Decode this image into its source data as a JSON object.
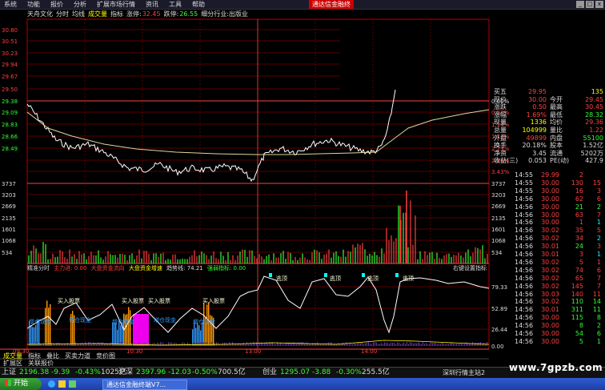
{
  "menu": [
    "系统",
    "功能",
    "报价",
    "分析",
    "扩展市场行情",
    "资讯",
    "工具",
    "帮助"
  ],
  "window_title": "通达信金融终",
  "window_buttons": [
    "_",
    "□",
    "x"
  ],
  "chart_header": {
    "stock_name": "天舟文化",
    "tabs": [
      "分时",
      "均线",
      "成交量",
      "指标"
    ],
    "limit_up_label": "涨停:",
    "limit_up_value": "32.45",
    "limit_down_label": "跌停:",
    "limit_down_value": "26.55",
    "industry": "细分行业:出版业"
  },
  "price_axis_left": [
    "30.80",
    "30.51",
    "30.23",
    "29.94",
    "29.67",
    "29.50",
    "29.38",
    "29.09",
    "28.83",
    "28.66",
    "28.49"
  ],
  "price_axis_right_pct": [
    "0.00%",
    "0.57%",
    "1.14%",
    "1.71%",
    "2.29%",
    "2.86%",
    "3.43%"
  ],
  "volume_axis_left": [
    "3737",
    "3203",
    "2669",
    "2135",
    "1601",
    "1068",
    "534"
  ],
  "volume_axis_right": [
    "3737",
    "3203",
    "2669",
    "2135",
    "1601",
    "1068",
    "534"
  ],
  "indicator_header": {
    "name": "精准分时",
    "items": [
      {
        "label": "主力进: 0.00",
        "color": "#ff4040"
      },
      {
        "label": "大盘资金流向",
        "color": "#ff4040"
      },
      {
        "label": "大盘资金增速",
        "color": "#ff0"
      },
      {
        "label": "趋势线: 74.21",
        "color": "#ddd"
      },
      {
        "label": "强弱指标: 0.00",
        "color": "#3f3"
      }
    ],
    "right_label": "右键设置指标"
  },
  "indicator_axis_right": [
    "79.33",
    "52.89",
    "26.44",
    "0.00"
  ],
  "indicator_labels": {
    "buy": "买入股票",
    "add": "增仓现金",
    "tao": "逃顶"
  },
  "time_axis": [
    "09:30",
    "10:30",
    "13:00",
    "14:00"
  ],
  "bottom_tabs": [
    "成交量",
    "指标",
    "叠比",
    "买卖力道",
    "竞价图"
  ],
  "bottom_tabs2": [
    "扩展区",
    "关联报价"
  ],
  "quote_panel": [
    {
      "l": "买五",
      "v": "29.95",
      "l2": "",
      "v2": "135",
      "c": "#ff4040",
      "c2": "#ff0"
    },
    {
      "l": "现价",
      "v": "30.00",
      "l2": "今开",
      "v2": "29.45",
      "c": "#ff4040",
      "c2": "#ff4040"
    },
    {
      "l": "涨跌",
      "v": "0.50",
      "l2": "最高",
      "v2": "30.45",
      "c": "#ff4040",
      "c2": "#ff4040"
    },
    {
      "l": "涨幅",
      "v": "1.69%",
      "l2": "最低",
      "v2": "28.32",
      "c": "#ff4040",
      "c2": "#3f3"
    },
    {
      "l": "现量",
      "v": "1336",
      "l2": "均价",
      "v2": "29.36",
      "c": "#ff0",
      "c2": "#ff4040"
    },
    {
      "l": "总量",
      "v": "104999",
      "l2": "量比",
      "v2": "1.22",
      "c": "#ff0",
      "c2": "#ff4040"
    },
    {
      "l": "外盘",
      "v": "49899",
      "l2": "内盘",
      "v2": "55100",
      "c": "#ff4040",
      "c2": "#3f3"
    },
    {
      "l": "换手",
      "v": "20.18%",
      "l2": "股本",
      "v2": "1.52亿",
      "c": "#ddd",
      "c2": "#ddd"
    },
    {
      "l": "净资",
      "v": "3.45",
      "l2": "流通",
      "v2": "5202万",
      "c": "#ddd",
      "c2": "#ddd"
    },
    {
      "l": "收益(三)",
      "v": "0.053",
      "l2": "PE(动)",
      "v2": "427.9",
      "c": "#ddd",
      "c2": "#ddd"
    }
  ],
  "ticks": [
    {
      "t": "14:55",
      "p": "29.99",
      "v": "2",
      "c": "#ff4040",
      "d": "",
      "dc": "#ff4040"
    },
    {
      "t": "14:55",
      "p": "30.00",
      "v": "130",
      "c": "#ff4040",
      "d": "15",
      "dc": "#ff4040"
    },
    {
      "t": "14:55",
      "p": "30.00",
      "v": "16",
      "c": "#ff4040",
      "d": "3",
      "dc": "#ff4040"
    },
    {
      "t": "14:56",
      "p": "30.00",
      "v": "62",
      "c": "#ff4040",
      "d": "6",
      "dc": "#ff4040"
    },
    {
      "t": "14:56",
      "p": "30.00",
      "v": "21",
      "c": "#3f3",
      "d": "2",
      "dc": "#3f3"
    },
    {
      "t": "14:56",
      "p": "30.00",
      "v": "63",
      "c": "#ff4040",
      "d": "7",
      "dc": "#ff4040"
    },
    {
      "t": "14:56",
      "p": "30.00",
      "v": "1",
      "c": "#ff4040",
      "d": "1",
      "dc": "#0ff"
    },
    {
      "t": "14:56",
      "p": "30.02",
      "v": "35",
      "c": "#ff4040",
      "d": "5",
      "dc": "#ff4040"
    },
    {
      "t": "14:56",
      "p": "30.02",
      "v": "34",
      "c": "#ff4040",
      "d": "2",
      "dc": "#0ff"
    },
    {
      "t": "14:56",
      "p": "30.01",
      "v": "24",
      "c": "#3f3",
      "d": "3",
      "dc": "#ff4040"
    },
    {
      "t": "14:56",
      "p": "30.01",
      "v": "3",
      "c": "#ff4040",
      "d": "1",
      "dc": "#0ff"
    },
    {
      "t": "14:56",
      "p": "30.02",
      "v": "5",
      "c": "#ff4040",
      "d": "1",
      "dc": "#ff4040"
    },
    {
      "t": "14:56",
      "p": "30.02",
      "v": "74",
      "c": "#ff4040",
      "d": "6",
      "dc": "#ff4040"
    },
    {
      "t": "14:56",
      "p": "30.02",
      "v": "65",
      "c": "#ff4040",
      "d": "7",
      "dc": "#ff4040"
    },
    {
      "t": "14:56",
      "p": "30.02",
      "v": "145",
      "c": "#ff4040",
      "d": "7",
      "dc": "#ff4040"
    },
    {
      "t": "14:56",
      "p": "30.03",
      "v": "140",
      "c": "#ff4040",
      "d": "11",
      "dc": "#ff4040"
    },
    {
      "t": "14:56",
      "p": "30.02",
      "v": "110",
      "c": "#3f3",
      "d": "14",
      "dc": "#3f3"
    },
    {
      "t": "14:56",
      "p": "30.01",
      "v": "311",
      "c": "#3f3",
      "d": "11",
      "dc": "#3f3"
    },
    {
      "t": "14:56",
      "p": "30.00",
      "v": "115",
      "c": "#3f3",
      "d": "8",
      "dc": "#3f3"
    },
    {
      "t": "14:56",
      "p": "30.00",
      "v": "8",
      "c": "#3f3",
      "d": "2",
      "dc": "#3f3"
    },
    {
      "t": "14:56",
      "p": "30.00",
      "v": "54",
      "c": "#3f3",
      "d": "6",
      "dc": "#3f3"
    },
    {
      "t": "14:56",
      "p": "30.00",
      "v": "5",
      "c": "#3f3",
      "d": "1",
      "dc": "#3f3"
    }
  ],
  "status_bar": [
    {
      "name": "上证",
      "value": "2196.38",
      "chg": "-9.39",
      "pct": "-0.43%",
      "amt": "1025亿"
    },
    {
      "name": "沪深",
      "value": "2397.96",
      "chg": "-12.03",
      "pct": "-0.50%",
      "amt": "700.5亿"
    },
    {
      "name": "创业",
      "value": "1295.07",
      "chg": "-3.88",
      "pct": "-0.30%",
      "amt": "255.5亿"
    }
  ],
  "status_right": "深圳行情主站2",
  "taskbar": {
    "start": "开始",
    "task": "通达信金融终端V7..."
  },
  "watermark": "www.7gpzb.com",
  "colors": {
    "grid": "#b00000",
    "price": "#ffffff",
    "avg": "#ffff66",
    "up": "#ff4040",
    "down": "#33ff33"
  },
  "chart_data": {
    "type": "line",
    "x": [
      "09:30",
      "10:30",
      "13:00",
      "14:00",
      "15:00"
    ],
    "series": [
      {
        "name": "price",
        "values": [
          29.6,
          29.4,
          28.95,
          28.45,
          28.6,
          28.8,
          29.3,
          30.0
        ]
      },
      {
        "name": "average",
        "values": [
          29.4,
          29.1,
          28.85,
          28.75,
          28.7,
          28.78,
          29.05,
          29.36
        ]
      }
    ],
    "ylim": [
      28.49,
      30.8
    ]
  }
}
